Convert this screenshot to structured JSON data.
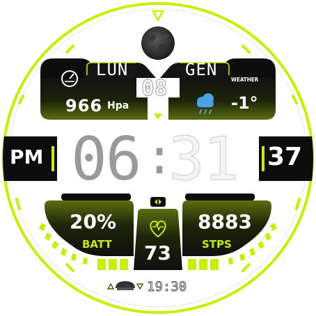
{
  "colors": {
    "accent": "#c8ef00",
    "panel_dark": "#0d0d0d",
    "panel_olive": "#4a5a10",
    "background": "#ffffff",
    "hour_digits": "#9a9a9a",
    "text_light": "#f4f4f4"
  },
  "date": {
    "day_of_week": "LUN",
    "month": "GEN",
    "day": "08"
  },
  "moon_phase": {
    "icon": "moon-full-icon"
  },
  "pressure": {
    "value": "966",
    "unit": "Hpa",
    "icon": "gauge-icon"
  },
  "weather": {
    "label": "WEATHER",
    "temperature": "-1°",
    "icon": "cloud-rain-icon"
  },
  "time": {
    "ampm": "PM",
    "hours": "06",
    "separator": ":",
    "minutes": "31",
    "seconds": "37"
  },
  "battery": {
    "value": "20%",
    "label": "BATT",
    "level_percent": 20
  },
  "heart_rate": {
    "value": "73",
    "icon": "heart-icon"
  },
  "steps": {
    "value": "8883",
    "label": "STPS",
    "progress_percent": 88
  },
  "alarm": {
    "time": "19:30",
    "icon": "alarm-bell-icon"
  }
}
